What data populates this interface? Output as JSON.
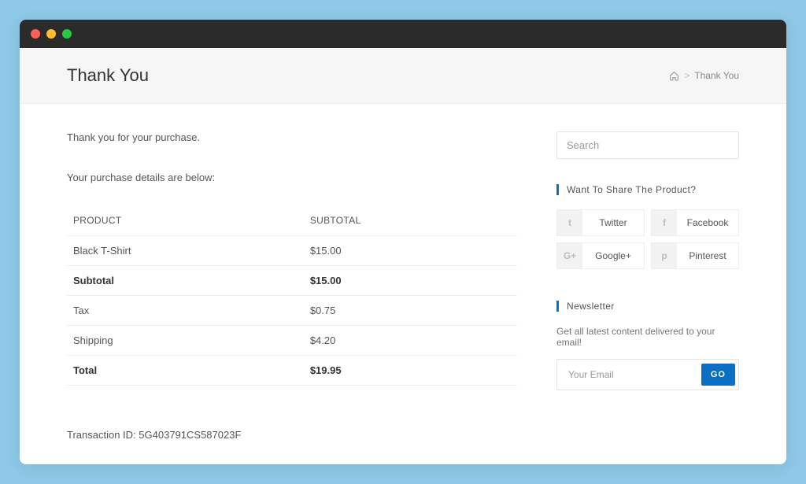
{
  "header": {
    "title": "Thank You",
    "breadcrumb_current": "Thank You"
  },
  "main": {
    "thank_you_msg": "Thank you for your purchase.",
    "details_msg": "Your purchase details are below:",
    "columns": {
      "product": "PRODUCT",
      "subtotal": "SUBTOTAL"
    },
    "rows": [
      {
        "label": "Black T-Shirt",
        "value": "$15.00",
        "bold": false
      },
      {
        "label": "Subtotal",
        "value": "$15.00",
        "bold": true
      },
      {
        "label": "Tax",
        "value": "$0.75",
        "bold": false
      },
      {
        "label": "Shipping",
        "value": "$4.20",
        "bold": false
      },
      {
        "label": "Total",
        "value": "$19.95",
        "bold": true
      }
    ],
    "transaction_label": "Transaction ID:",
    "transaction_id": "5G403791CS587023F"
  },
  "sidebar": {
    "search_placeholder": "Search",
    "share_title": "Want To Share The Product?",
    "share": [
      {
        "name": "twitter",
        "label": "Twitter",
        "glyph": "t"
      },
      {
        "name": "facebook",
        "label": "Facebook",
        "glyph": "f"
      },
      {
        "name": "google",
        "label": "Google+",
        "glyph": "G+"
      },
      {
        "name": "pinterest",
        "label": "Pinterest",
        "glyph": "p"
      }
    ],
    "newsletter_title": "Newsletter",
    "newsletter_desc": "Get all latest content delivered to your email!",
    "email_placeholder": "Your Email",
    "go_label": "GO"
  }
}
